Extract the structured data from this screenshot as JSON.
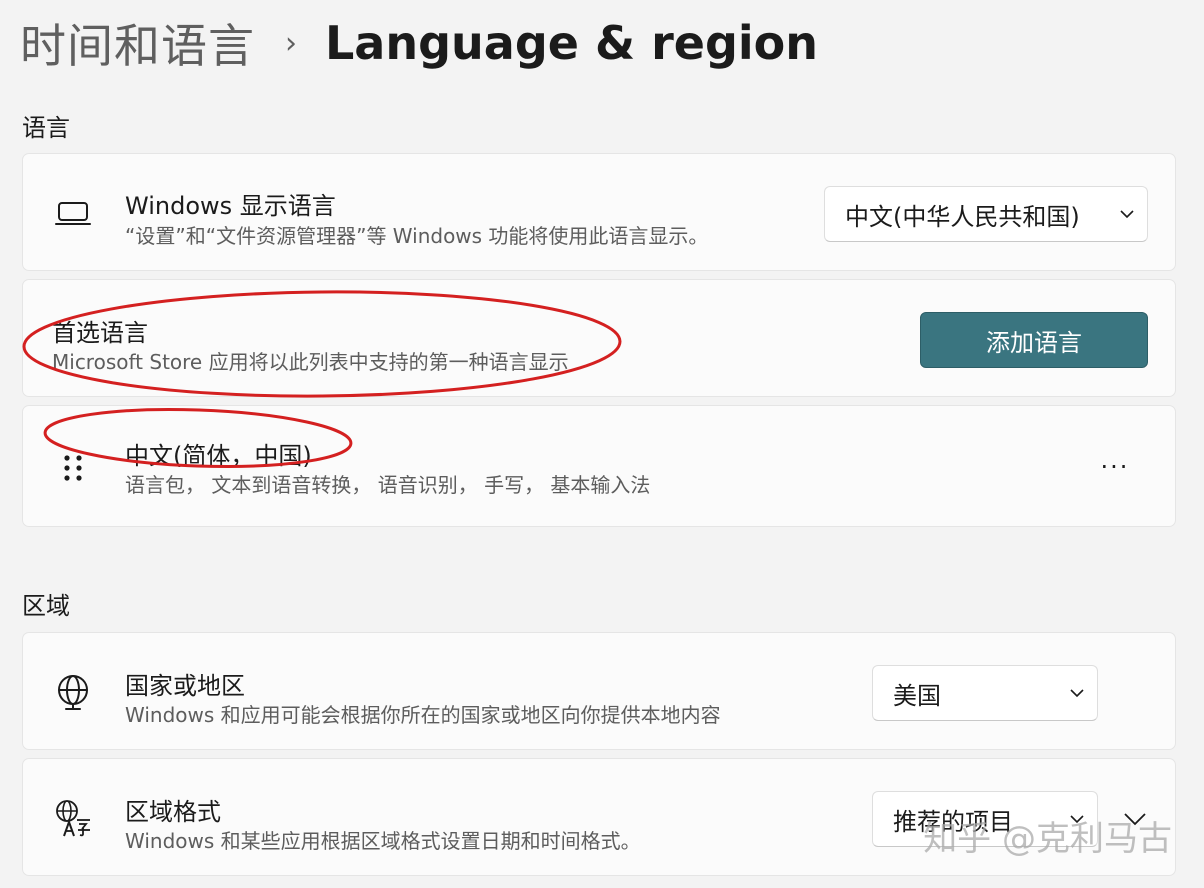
{
  "breadcrumb": {
    "parent": "时间和语言",
    "separator": "›",
    "current": "Language & region"
  },
  "language_section": {
    "title": "语言",
    "display_language": {
      "icon": "laptop-icon",
      "title": "Windows 显示语言",
      "description": "“设置”和“文件资源管理器”等 Windows 功能将使用此语言显示。",
      "selected": "中文(中华人民共和国)"
    },
    "preferred_languages": {
      "title": "首选语言",
      "description": "Microsoft Store 应用将以此列表中支持的第一种语言显示",
      "add_button": "添加语言"
    },
    "language_item": {
      "icon": "drag-handle-icon",
      "title": "中文(简体，中国)",
      "description": "语言包， 文本到语音转换， 语音识别， 手写， 基本输入法",
      "more": "···"
    }
  },
  "region_section": {
    "title": "区域",
    "country": {
      "icon": "globe-icon",
      "title": "国家或地区",
      "description": "Windows 和应用可能会根据你所在的国家或地区向你提供本地内容",
      "selected": "美国"
    },
    "regional_format": {
      "icon": "language-glyph-icon",
      "title": "区域格式",
      "description": "Windows 和某些应用根据区域格式设置日期和时间格式。",
      "selected": "推荐的项目"
    }
  },
  "watermark": "知乎 @克利马古",
  "colors": {
    "accent": "#3a7580",
    "annotation": "#d42020",
    "background": "#f3f3f3",
    "card": "#fbfbfb"
  }
}
